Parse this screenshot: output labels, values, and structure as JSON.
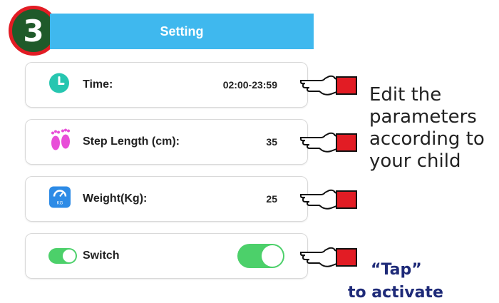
{
  "step_number": "3",
  "header": {
    "title": "Setting"
  },
  "rows": [
    {
      "label": "Time:",
      "value": "02:00-23:59"
    },
    {
      "label": "Step Length (cm):",
      "value": "35"
    },
    {
      "label": "Weight(Kg):",
      "value": "25",
      "icon_text": "KG"
    },
    {
      "label": "Switch",
      "toggle_on": true
    }
  ],
  "caption": {
    "line1": "Edit the",
    "line2": "parameters",
    "line3": "according to",
    "line4": "your child"
  },
  "tap": {
    "line1": "“Tap”",
    "line2": "to activate"
  },
  "colors": {
    "header": "#3fb8ee",
    "toggle": "#4cd06a",
    "badge_fill": "#1f5a2a",
    "badge_ring": "#e21c24",
    "tap_text": "#1e2a78"
  }
}
